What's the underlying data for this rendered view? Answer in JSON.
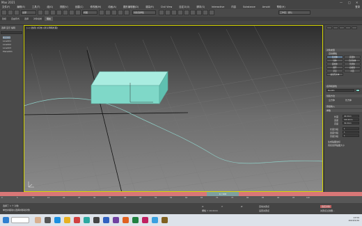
{
  "window": {
    "title": "Max 2021"
  },
  "menu": {
    "items": [
      "文件(F)",
      "编辑(E)",
      "工具(T)",
      "组(G)",
      "视图(V)",
      "创建(C)",
      "修改器(M)",
      "动画(A)",
      "图形编辑器(D)",
      "渲染(R)",
      "Civil View",
      "自定义(U)",
      "脚本(S)",
      "Interactive",
      "内容",
      "Substance",
      "Arnold",
      "帮助(H)"
    ],
    "user_label": "登录"
  },
  "toolbar": {
    "filter_value": "全部",
    "view_value": "视图",
    "selection_set": "创建选择集"
  },
  "ribbon": {
    "tabs": [
      "建模",
      "自由形式",
      "选择",
      "对象绘制",
      "填充"
    ],
    "right_label": "工作区：默认"
  },
  "left_panel": {
    "tabs": [
      "选择",
      "显示",
      "编辑"
    ],
    "items": [
      "Box001",
      "Line001",
      "Line002",
      "Line003",
      "Plane001"
    ]
  },
  "viewport": {
    "label": "[+] [透视] [标准] [默认明暗处理]"
  },
  "right_panel": {
    "section_object_type": "对象类型",
    "auto_grid": "自动栅格",
    "buttons": [
      "长方体",
      "圆锥体",
      "球体",
      "几何球体",
      "圆柱体",
      "管状体",
      "圆环",
      "四棱锥",
      "茶壶",
      "平面",
      "加强型文本"
    ],
    "section_name_color": "名称和颜色",
    "name_value": "Box001",
    "section_create_method": "创建方法",
    "create_methods": [
      "立方体",
      "长方体"
    ],
    "section_keyboard": "键盘输入",
    "section_params": "参数",
    "params": [
      {
        "label": "长度",
        "value": "40.0mm"
      },
      {
        "label": "宽度",
        "value": "100.0mm"
      },
      {
        "label": "高度",
        "value": "30.0mm"
      },
      {
        "label": "长度分段",
        "value": "1"
      },
      {
        "label": "宽度分段",
        "value": "1"
      },
      {
        "label": "高度分段",
        "value": "1"
      }
    ],
    "gen_uv": "生成贴图坐标",
    "real_world": "真实世界贴图大小"
  },
  "timeline": {
    "frame_label": "0 / 100"
  },
  "trackbar": {
    "ticks": [
      "0",
      "5",
      "10",
      "15",
      "20",
      "25",
      "30",
      "35",
      "40",
      "45",
      "50",
      "55",
      "60",
      "65",
      "70",
      "75",
      "80",
      "85",
      "90",
      "95",
      "100"
    ]
  },
  "status": {
    "selected": "选择了 1 个 对象",
    "hint": "单击并拖动以选择并移动对象",
    "x_label": "X:",
    "y_label": "Y:",
    "z_label": "Z:",
    "grid_label": "栅格 = 10.0mm",
    "autokey": "自动关键点",
    "setkey": "设置关键点",
    "selected_obj": "选定对象",
    "filter_key": "关键点过滤器..."
  },
  "taskbar": {
    "time": "13:59",
    "date": "2023/5/30"
  },
  "colors": {
    "box": "#7fd8c8",
    "timeline": "#d97777",
    "viewport_border": "#d7d700"
  }
}
